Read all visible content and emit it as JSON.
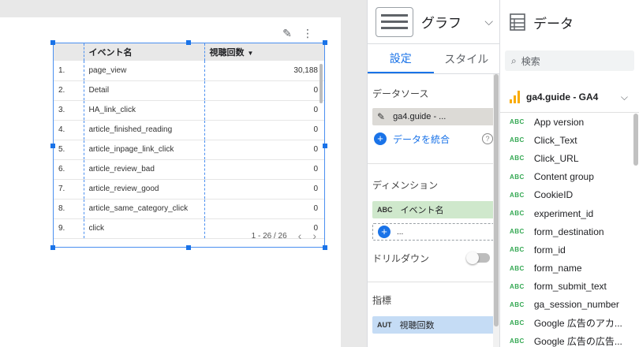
{
  "report_table": {
    "headers": {
      "name": "イベント名",
      "value": "視聴回数"
    },
    "rows": [
      {
        "num": "1.",
        "name": "page_view",
        "value": "30,188"
      },
      {
        "num": "2.",
        "name": "Detail",
        "value": "0"
      },
      {
        "num": "3.",
        "name": "HA_link_click",
        "value": "0"
      },
      {
        "num": "4.",
        "name": "article_finished_reading",
        "value": "0"
      },
      {
        "num": "5.",
        "name": "article_inpage_link_click",
        "value": "0"
      },
      {
        "num": "6.",
        "name": "article_review_bad",
        "value": "0"
      },
      {
        "num": "7.",
        "name": "article_review_good",
        "value": "0"
      },
      {
        "num": "8.",
        "name": "article_same_category_click",
        "value": "0"
      },
      {
        "num": "9.",
        "name": "click",
        "value": "0"
      }
    ],
    "pagination": "1 - 26 / 26"
  },
  "properties_panel": {
    "title": "グラフ",
    "tabs": {
      "setup": "設定",
      "style": "スタイル"
    },
    "data_source_label": "データソース",
    "data_source_value": "ga4.guide - ...",
    "blend_label": "データを統合",
    "dimension_label": "ディメンション",
    "dimension_tag": "ABC",
    "dimension_value": "イベント名",
    "add_dimension_text": "...",
    "drilldown_label": "ドリルダウン",
    "metric_label": "指標",
    "metric_tag": "AUT",
    "metric_value": "視聴回数"
  },
  "data_panel": {
    "title": "データ",
    "search_placeholder": "検索",
    "source_name": "ga4.guide - GA4",
    "field_tag": "ABC",
    "fields": [
      "App version",
      "Click_Text",
      "Click_URL",
      "Content group",
      "CookieID",
      "experiment_id",
      "form_destination",
      "form_id",
      "form_name",
      "form_submit_text",
      "ga_session_number",
      "Google 広告のアカ...",
      "Google 広告の広告..."
    ]
  },
  "colors": {
    "accent_blue": "#1a73e8",
    "selection_blue": "#4a8ff0",
    "dimension_green": "#cfe8cc",
    "metric_blue": "#c5dcf5",
    "field_tag_green": "#34a853",
    "ga_orange": "#f9ab00"
  }
}
